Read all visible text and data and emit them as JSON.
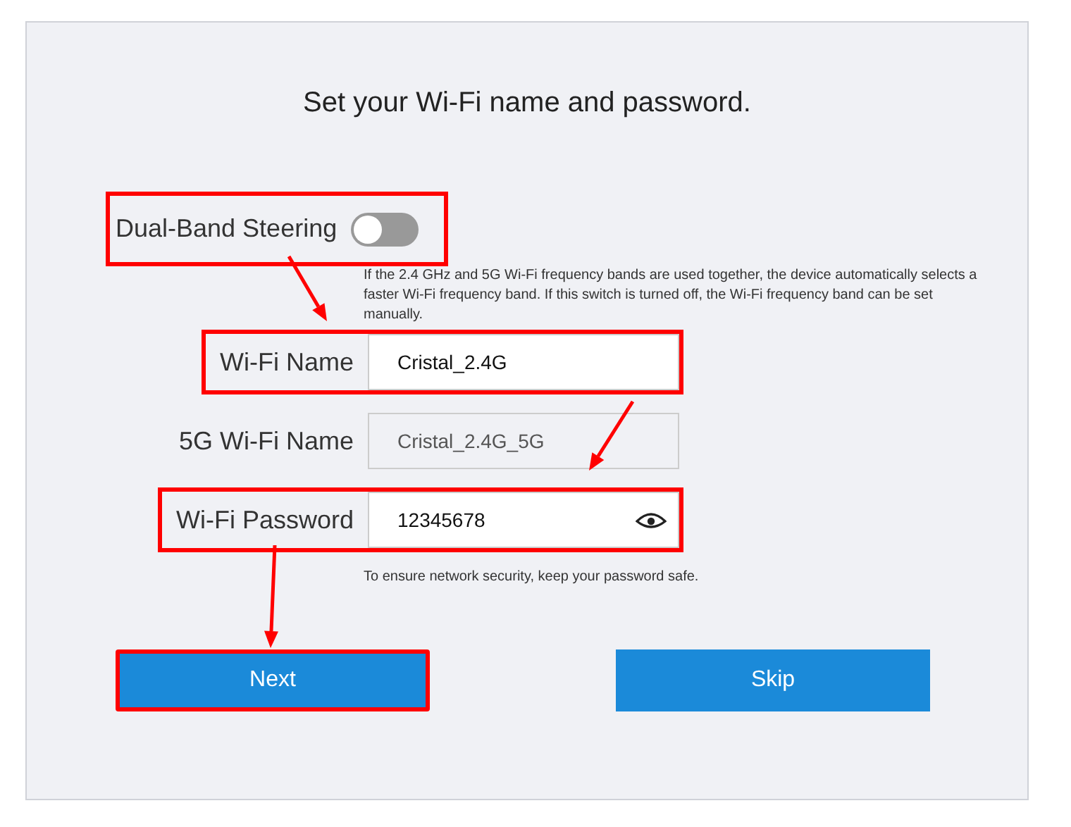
{
  "title": "Set your Wi-Fi name and password.",
  "steering": {
    "label": "Dual-Band Steering",
    "on": false,
    "highlighted": true,
    "description": "If the 2.4 GHz and 5G Wi-Fi frequency bands are used together, the device automatically selects a faster Wi-Fi frequency band. If this switch is turned off, the Wi-Fi frequency band can be set manually."
  },
  "fields": [
    {
      "label": "Wi-Fi Name",
      "value": "Cristal_2.4G",
      "disabled": false,
      "highlighted": true,
      "kind": "text"
    },
    {
      "label": "5G Wi-Fi Name",
      "value": "Cristal_2.4G_5G",
      "disabled": true,
      "highlighted": false,
      "kind": "text"
    },
    {
      "label": "Wi-Fi Password",
      "value": "12345678",
      "disabled": false,
      "highlighted": true,
      "kind": "password"
    }
  ],
  "password_hint": "To ensure network security, keep your password safe.",
  "buttons": [
    {
      "label": "Next",
      "highlighted": true
    },
    {
      "label": "Skip",
      "highlighted": false
    }
  ]
}
